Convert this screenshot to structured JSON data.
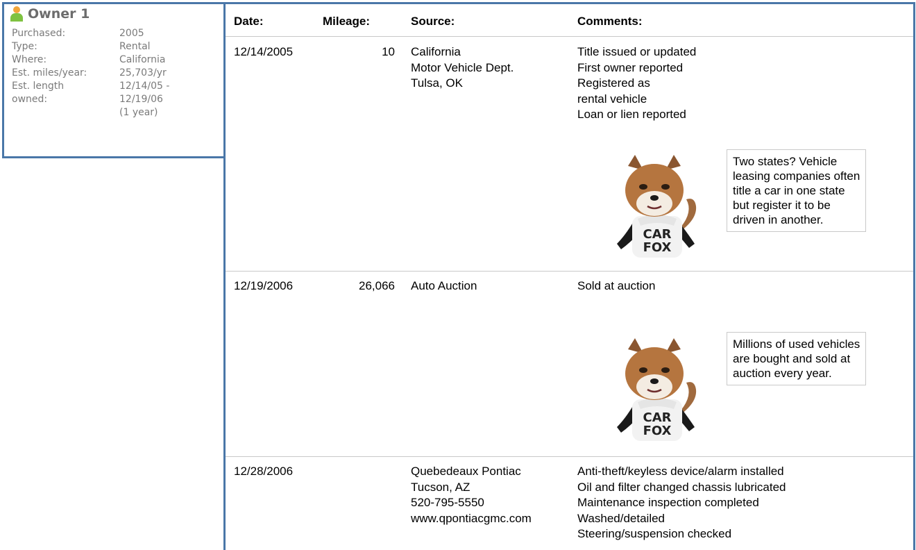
{
  "owner": {
    "title": "Owner 1",
    "fields": [
      {
        "label": "Purchased:",
        "value": [
          "2005"
        ]
      },
      {
        "label": "Type:",
        "value": [
          "Rental"
        ]
      },
      {
        "label": "Where:",
        "value": [
          "California"
        ]
      },
      {
        "label": "Est. miles/year:",
        "value": [
          "25,703/yr"
        ]
      },
      {
        "label": "Est. length",
        "value": [
          "12/14/05 -"
        ]
      },
      {
        "label": "owned:",
        "value": [
          "12/19/06"
        ]
      },
      {
        "label": "",
        "value": [
          "(1 year)"
        ]
      }
    ]
  },
  "history": {
    "headers": {
      "date": "Date:",
      "mileage": "Mileage:",
      "source": "Source:",
      "comments": "Comments:"
    },
    "records": [
      {
        "date": "12/14/2005",
        "mileage": "10",
        "source": [
          "California",
          "Motor Vehicle Dept.",
          "Tulsa, OK"
        ],
        "comments": [
          "Title issued or updated",
          "First owner reported",
          "Registered as",
          "rental vehicle",
          "Loan or lien reported"
        ],
        "tip": [
          "Two states? Vehicle",
          "leasing companies often",
          "title a car in one state",
          "but register it to be",
          "driven in another."
        ],
        "mascot_text": [
          "CAR",
          "FOX"
        ]
      },
      {
        "date": "12/19/2006",
        "mileage": "26,066",
        "source": [
          "Auto Auction"
        ],
        "comments": [
          "Sold at auction"
        ],
        "tip": [
          "Millions of used vehicles",
          "are bought and sold at",
          "auction every year."
        ],
        "mascot_text": [
          "CAR",
          "FOX"
        ]
      },
      {
        "date": "12/28/2006",
        "mileage": "",
        "source": [
          "Quebedeaux Pontiac",
          "Tucson, AZ",
          "520-795-5550",
          "www.qpontiacgmc.com"
        ],
        "comments": [
          "Anti-theft/keyless device/alarm installed",
          "Oil and filter changed chassis lubricated",
          "Maintenance inspection completed",
          "Washed/detailed",
          "Steering/suspension checked"
        ]
      }
    ]
  },
  "colors": {
    "border": "#4a77a8",
    "label_gray": "#7a7a7a",
    "title_gray": "#6c6c6c"
  },
  "icons": {
    "owner": "person-icon",
    "mascot": "car-fox-mascot"
  }
}
